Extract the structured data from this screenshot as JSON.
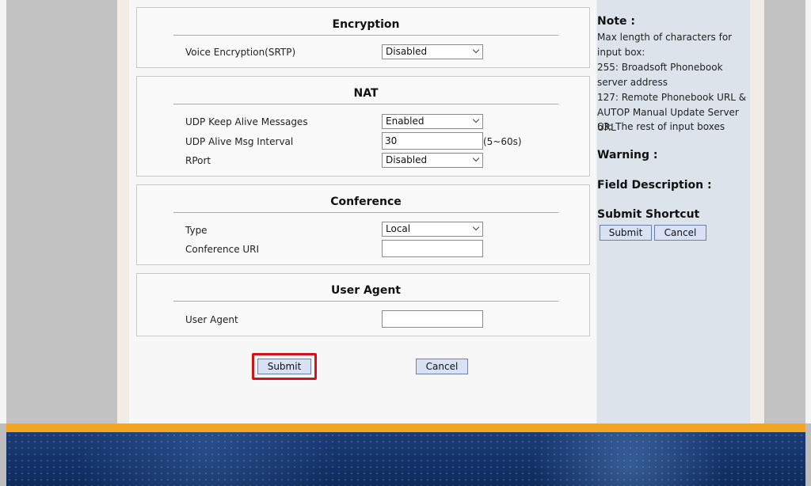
{
  "encryption": {
    "title": "Encryption",
    "voice_label": "Voice Encryption(SRTP)",
    "voice_value": "Disabled"
  },
  "nat": {
    "title": "NAT",
    "keepalive_label": "UDP Keep Alive Messages",
    "keepalive_value": "Enabled",
    "interval_label": "UDP Alive Msg Interval",
    "interval_value": "30",
    "interval_hint": "(5~60s)",
    "rport_label": "RPort",
    "rport_value": "Disabled"
  },
  "conference": {
    "title": "Conference",
    "type_label": "Type",
    "type_value": "Local",
    "uri_label": "Conference URI",
    "uri_value": ""
  },
  "user_agent": {
    "title": "User Agent",
    "label": "User Agent",
    "value": ""
  },
  "actions": {
    "submit": "Submit",
    "cancel": "Cancel"
  },
  "side": {
    "note_title": "Note :",
    "note_lines": [
      "Max length of characters for input box:",
      "255: Broadsoft Phonebook server address",
      "127: Remote Phonebook URL & AUTOP Manual Update Server URL",
      "63: The rest of input boxes"
    ],
    "warning_title": "Warning :",
    "field_desc_title": "Field Description :",
    "shortcut_title": "Submit Shortcut",
    "shortcut_submit": "Submit",
    "shortcut_cancel": "Cancel"
  }
}
